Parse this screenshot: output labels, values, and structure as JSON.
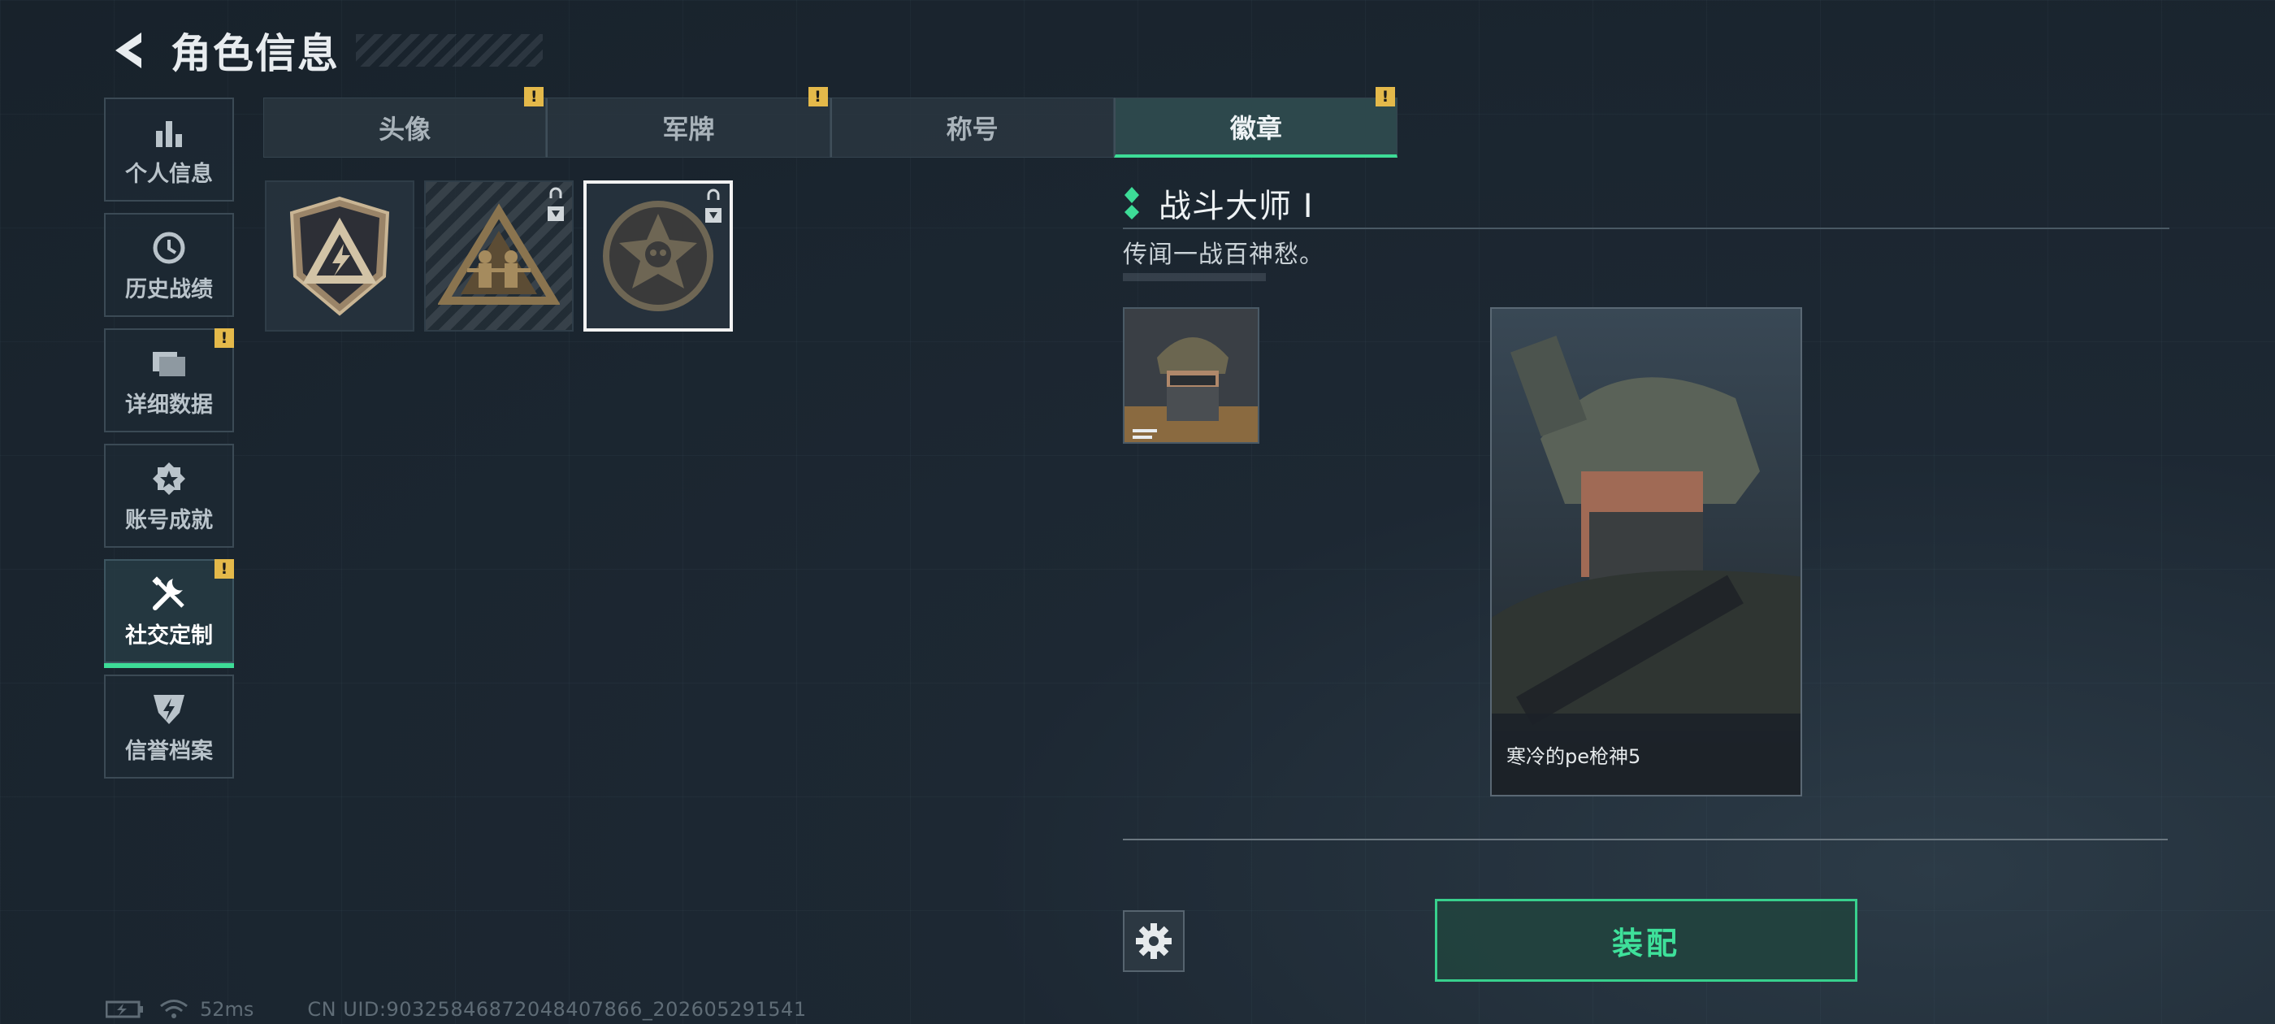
{
  "header": {
    "title": "角色信息"
  },
  "sidebar": {
    "items": [
      {
        "label": "个人信息",
        "icon": "bar-chart-icon",
        "alert": false,
        "active": false
      },
      {
        "label": "历史战绩",
        "icon": "history-icon",
        "alert": false,
        "active": false
      },
      {
        "label": "详细数据",
        "icon": "folder-icon",
        "alert": true,
        "active": false
      },
      {
        "label": "账号成就",
        "icon": "medal-icon",
        "alert": false,
        "active": false
      },
      {
        "label": "社交定制",
        "icon": "tools-icon",
        "alert": true,
        "active": true
      },
      {
        "label": "信誉档案",
        "icon": "shield-icon",
        "alert": false,
        "active": false
      }
    ],
    "alert_mark": "!"
  },
  "tabs": [
    {
      "label": "头像",
      "alert": true,
      "active": false
    },
    {
      "label": "军牌",
      "alert": true,
      "active": false
    },
    {
      "label": "称号",
      "alert": false,
      "active": false
    },
    {
      "label": "徽章",
      "alert": true,
      "active": true
    }
  ],
  "badges": [
    {
      "name": "triangle-lightning-badge",
      "locked": false,
      "selected": false
    },
    {
      "name": "soldiers-triangle-badge",
      "locked": true,
      "selected": false
    },
    {
      "name": "star-skull-badge",
      "locked": true,
      "selected": true
    }
  ],
  "detail": {
    "title": "战斗大师 Ⅰ",
    "description": "传闻一战百神愁。",
    "card_name": "寒冷的pe枪神5"
  },
  "actions": {
    "equip_label": "装配"
  },
  "status": {
    "ping": "52ms",
    "uid": "CN UID:90325846872048407866_202605291541"
  },
  "colors": {
    "accent": "#3ddc97",
    "alert": "#e4b94a",
    "background": "#1d2833"
  }
}
